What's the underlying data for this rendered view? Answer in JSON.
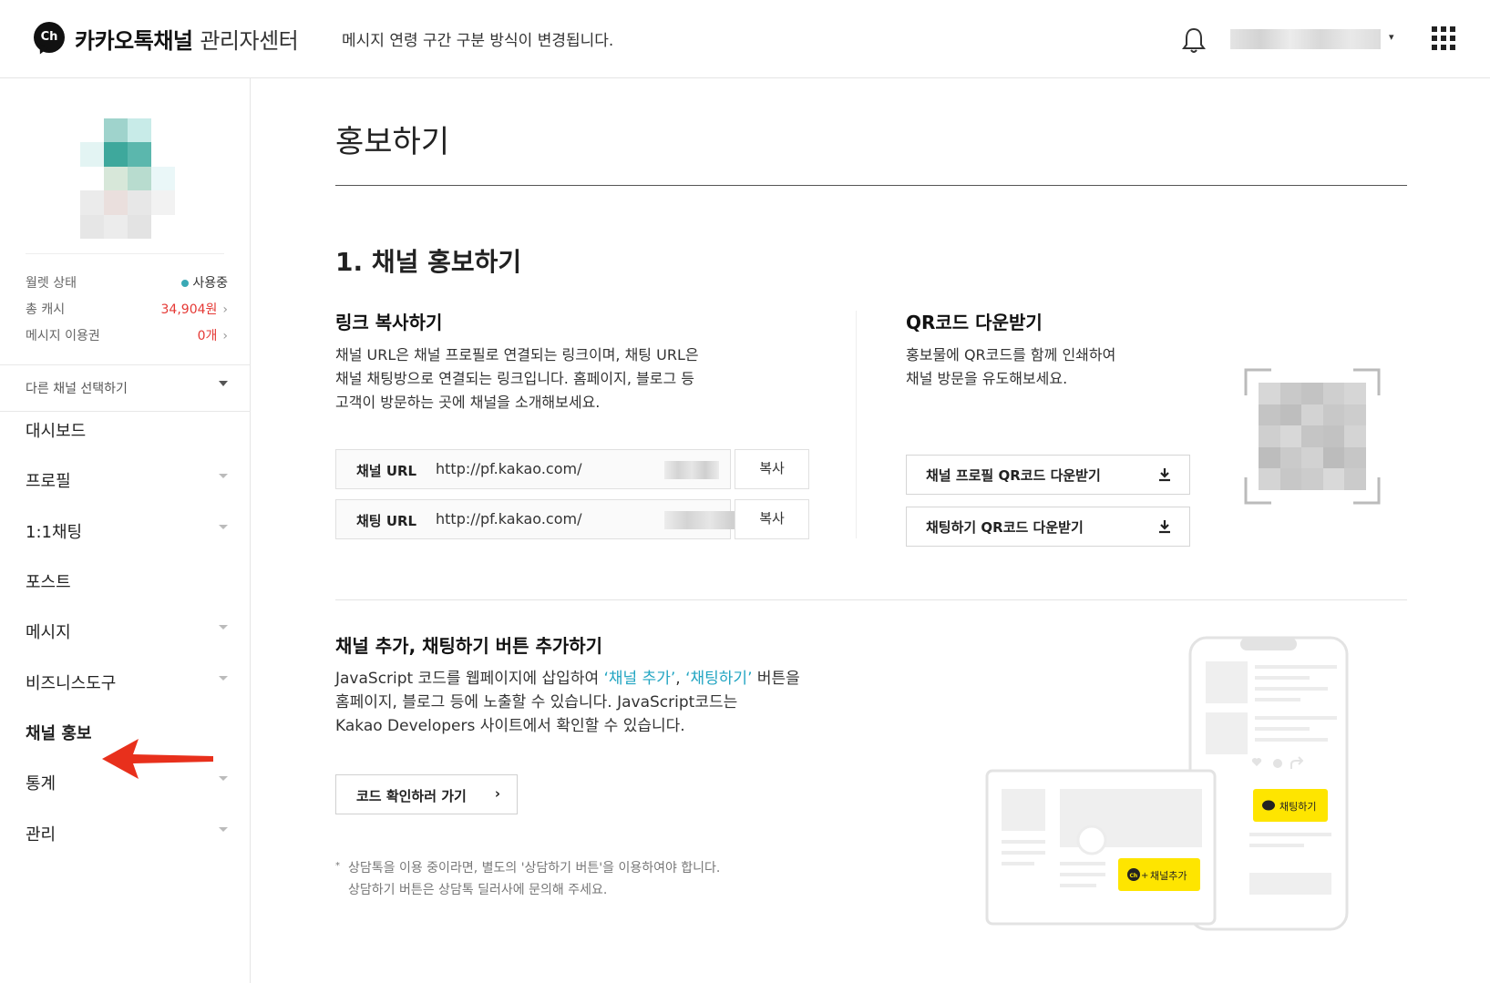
{
  "header": {
    "logo_text": "Ch",
    "brand_bold": "카카오톡채널",
    "brand_light": "관리자센터",
    "notice": "메시지 연령 구간 구분 방식이 변경됩니다."
  },
  "sidebar": {
    "wallet": [
      {
        "label": "월렛 상태",
        "value": "사용중"
      },
      {
        "label": "총 캐시",
        "value": "34,904원"
      },
      {
        "label": "메시지 이용권",
        "value": "0개"
      }
    ],
    "other_channel": "다른 채널 선택하기",
    "nav": [
      {
        "label": "대시보드",
        "expandable": false
      },
      {
        "label": "프로필",
        "expandable": true
      },
      {
        "label": "1:1채팅",
        "expandable": true
      },
      {
        "label": "포스트",
        "expandable": false
      },
      {
        "label": "메시지",
        "expandable": true
      },
      {
        "label": "비즈니스도구",
        "expandable": true
      },
      {
        "label": "채널 홍보",
        "expandable": false,
        "active": true
      },
      {
        "label": "통계",
        "expandable": true
      },
      {
        "label": "관리",
        "expandable": true
      }
    ]
  },
  "main": {
    "page_title": "홍보하기",
    "section1_title": "1. 채널 홍보하기",
    "link": {
      "title": "링크 복사하기",
      "desc": [
        "채널 URL은 채널 프로필로 연결되는 링크이며, 채팅 URL은",
        "채널 채팅방으로 연결되는 링크입니다. 홈페이지, 블로그 등",
        "고객이 방문하는 곳에 채널을 소개해보세요."
      ],
      "rows": [
        {
          "label": "채널 URL",
          "url": "http://pf.kakao.com/",
          "copy": "복사"
        },
        {
          "label": "채팅 URL",
          "url": "http://pf.kakao.com/",
          "copy": "복사"
        }
      ]
    },
    "qr": {
      "title": "QR코드 다운받기",
      "desc": [
        "홍보물에 QR코드를 함께 인쇄하여",
        "채널 방문을 유도해보세요."
      ],
      "buttons": [
        "채널 프로필 QR코드 다운받기",
        "채팅하기 QR코드 다운받기"
      ]
    },
    "button_section": {
      "title": "채널 추가, 채팅하기 버튼 추가하기",
      "desc_l1_a": "JavaScript 코드를 웹페이지에 삽입하여 ",
      "desc_l1_hl1": "‘채널 추가’",
      "desc_l1_sep": ", ",
      "desc_l1_hl2": "‘채팅하기’",
      "desc_l1_b": " 버튼을",
      "desc_l2": "홈페이지, 블로그 등에 노출할 수 있습니다. JavaScript코드는",
      "desc_l3": "Kakao Developers 사이트에서 확인할 수 있습니다.",
      "code_button": "코드 확인하러 가기",
      "code_button_chevron": "›",
      "note_bullet": "*",
      "note_l1": "상담톡을 이용 중이라면, 별도의 '상담하기 버튼'을 이용하여야 합니다.",
      "note_l2": "상담하기 버튼은 상담톡 딜러사에 문의해 주세요.",
      "illus_chat_btn": "채팅하기",
      "illus_add_btn": "채널추가",
      "illus_add_logo": "Ch"
    }
  },
  "colors": {
    "accent_teal": "#22a5c2",
    "status_dot": "#3aa9b5",
    "cash_red": "#e53935",
    "kakao_yellow": "#fee500",
    "arrow_red": "#e8301c"
  },
  "icons": [
    "bell-icon",
    "apps-grid-icon",
    "download-icon",
    "chevron-right-icon",
    "caret-down-icon"
  ]
}
